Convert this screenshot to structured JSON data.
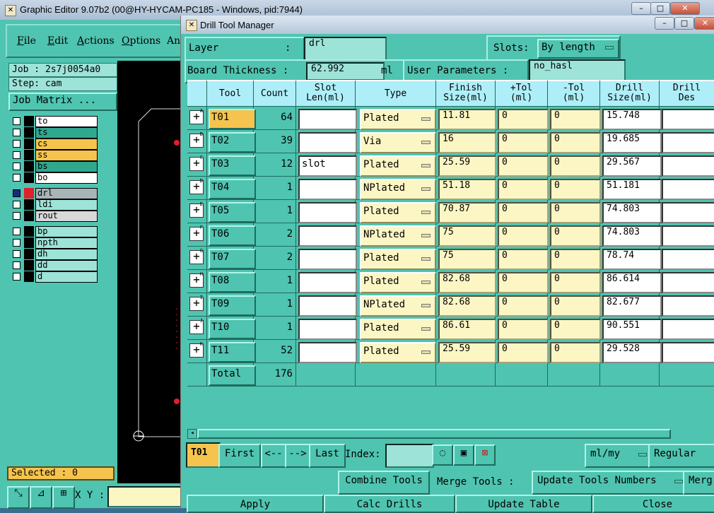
{
  "graphic_editor": {
    "title": "Graphic Editor 9.07b2 (00@HY-HYCAM-PC185 - Windows, pid:7944)",
    "menus": [
      "File",
      "Edit",
      "Actions",
      "Options",
      "An"
    ],
    "job_label": "Job : 2s7j0054a0",
    "step_label": "Step: cam",
    "job_matrix_button": "Job Matrix ...",
    "layers": [
      {
        "name": "to",
        "color": "#ffffff"
      },
      {
        "name": "ts",
        "color": "#2fa88e"
      },
      {
        "name": "cs",
        "color": "#f5c44e"
      },
      {
        "name": "ss",
        "color": "#f5c44e"
      },
      {
        "name": "bs",
        "color": "#2fa88e"
      },
      {
        "name": "bo",
        "color": "#ffffff"
      },
      {
        "name": "drl",
        "color": "#a9b4b8"
      },
      {
        "name": "ldi",
        "color": "#9de3d8"
      },
      {
        "name": "rout",
        "color": "#d8d8d8"
      },
      {
        "name": "bp",
        "color": "#9de3d8"
      },
      {
        "name": "npth",
        "color": "#9de3d8"
      },
      {
        "name": "dh",
        "color": "#9de3d8"
      },
      {
        "name": "dd",
        "color": "#9de3d8"
      },
      {
        "name": "d",
        "color": "#9de3d8"
      }
    ],
    "selected_label": "Selected : 0",
    "xy_label": "X Y :"
  },
  "drill_tool_manager": {
    "title": "Drill Tool Manager",
    "layer_label": "Layer",
    "layer_colon": ":",
    "layer_value": "drl",
    "slots_label": "Slots:",
    "slots_value": "By length",
    "board_thickness_label": "Board Thickness :",
    "board_thickness_value": "62.992",
    "board_thickness_unit": "ml",
    "user_params_label": "User Parameters :",
    "user_params_value": "no_hasl",
    "columns": [
      "Tool",
      "Count",
      "Slot\nLen(ml)",
      "Type",
      "Finish\nSize(ml)",
      "+Tol\n(ml)",
      "-Tol\n(ml)",
      "Drill\nSize(ml)",
      "Drill\nDes"
    ],
    "rows": [
      {
        "key": "A",
        "tool": "T01",
        "count": "64",
        "slot": "",
        "type": "Plated",
        "finish": "11.81",
        "ptol": "0",
        "mtol": "0",
        "drill": "15.748"
      },
      {
        "key": "B",
        "tool": "T02",
        "count": "39",
        "slot": "",
        "type": "Via",
        "finish": "16",
        "ptol": "0",
        "mtol": "0",
        "drill": "19.685"
      },
      {
        "key": "C",
        "tool": "T03",
        "count": "12",
        "slot": "slot",
        "type": "Plated",
        "finish": "25.59",
        "ptol": "0",
        "mtol": "0",
        "drill": "29.567"
      },
      {
        "key": "D",
        "tool": "T04",
        "count": "1",
        "slot": "",
        "type": "NPlated",
        "finish": "51.18",
        "ptol": "0",
        "mtol": "0",
        "drill": "51.181"
      },
      {
        "key": "E",
        "tool": "T05",
        "count": "1",
        "slot": "",
        "type": "Plated",
        "finish": "70.87",
        "ptol": "0",
        "mtol": "0",
        "drill": "74.803"
      },
      {
        "key": "F",
        "tool": "T06",
        "count": "2",
        "slot": "",
        "type": "NPlated",
        "finish": "75",
        "ptol": "0",
        "mtol": "0",
        "drill": "74.803"
      },
      {
        "key": "G",
        "tool": "T07",
        "count": "2",
        "slot": "",
        "type": "Plated",
        "finish": "75",
        "ptol": "0",
        "mtol": "0",
        "drill": "78.74"
      },
      {
        "key": "H",
        "tool": "T08",
        "count": "1",
        "slot": "",
        "type": "Plated",
        "finish": "82.68",
        "ptol": "0",
        "mtol": "0",
        "drill": "86.614"
      },
      {
        "key": "I",
        "tool": "T09",
        "count": "1",
        "slot": "",
        "type": "NPlated",
        "finish": "82.68",
        "ptol": "0",
        "mtol": "0",
        "drill": "82.677"
      },
      {
        "key": "J",
        "tool": "T10",
        "count": "1",
        "slot": "",
        "type": "Plated",
        "finish": "86.61",
        "ptol": "0",
        "mtol": "0",
        "drill": "90.551"
      },
      {
        "key": "K",
        "tool": "T11",
        "count": "52",
        "slot": "",
        "type": "Plated",
        "finish": "25.59",
        "ptol": "0",
        "mtol": "0",
        "drill": "29.528"
      }
    ],
    "total_label": "Total",
    "total_count": "176",
    "nav": {
      "current_tool": "T01",
      "first": "First",
      "prev": "<--",
      "next": "-->",
      "last": "Last",
      "index_label": "Index:",
      "units": "ml/my",
      "mode": "Regular"
    },
    "actions": {
      "combine": "Combine Tools",
      "merge_label": "Merge Tools :",
      "update_numbers": "Update Tools Numbers",
      "merge_cut": "Merg",
      "apply": "Apply",
      "calc": "Calc Drills",
      "update_table": "Update Table",
      "close": "Close"
    }
  }
}
